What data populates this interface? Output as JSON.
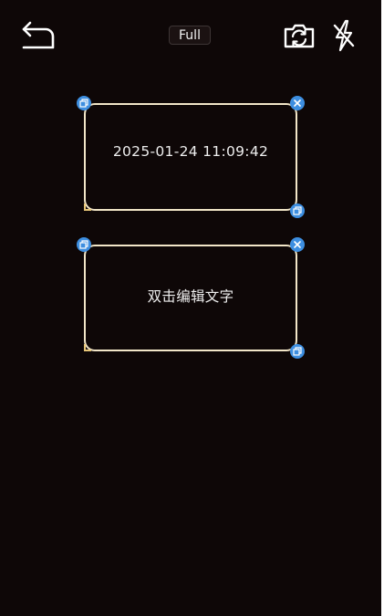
{
  "top_bar": {
    "back_icon": "back-arrow-icon",
    "mode_label": "Full",
    "switch_camera_icon": "switch-camera-icon",
    "flash_icon": "flash-off-icon"
  },
  "text_boxes": [
    {
      "text": "2025-01-24 11:09:42"
    },
    {
      "text": "双击编辑文字"
    }
  ],
  "colors": {
    "background": "#0e0707",
    "box_border": "#f2e6c8",
    "handle": "#3d8ee0",
    "text": "#eeeeee"
  }
}
